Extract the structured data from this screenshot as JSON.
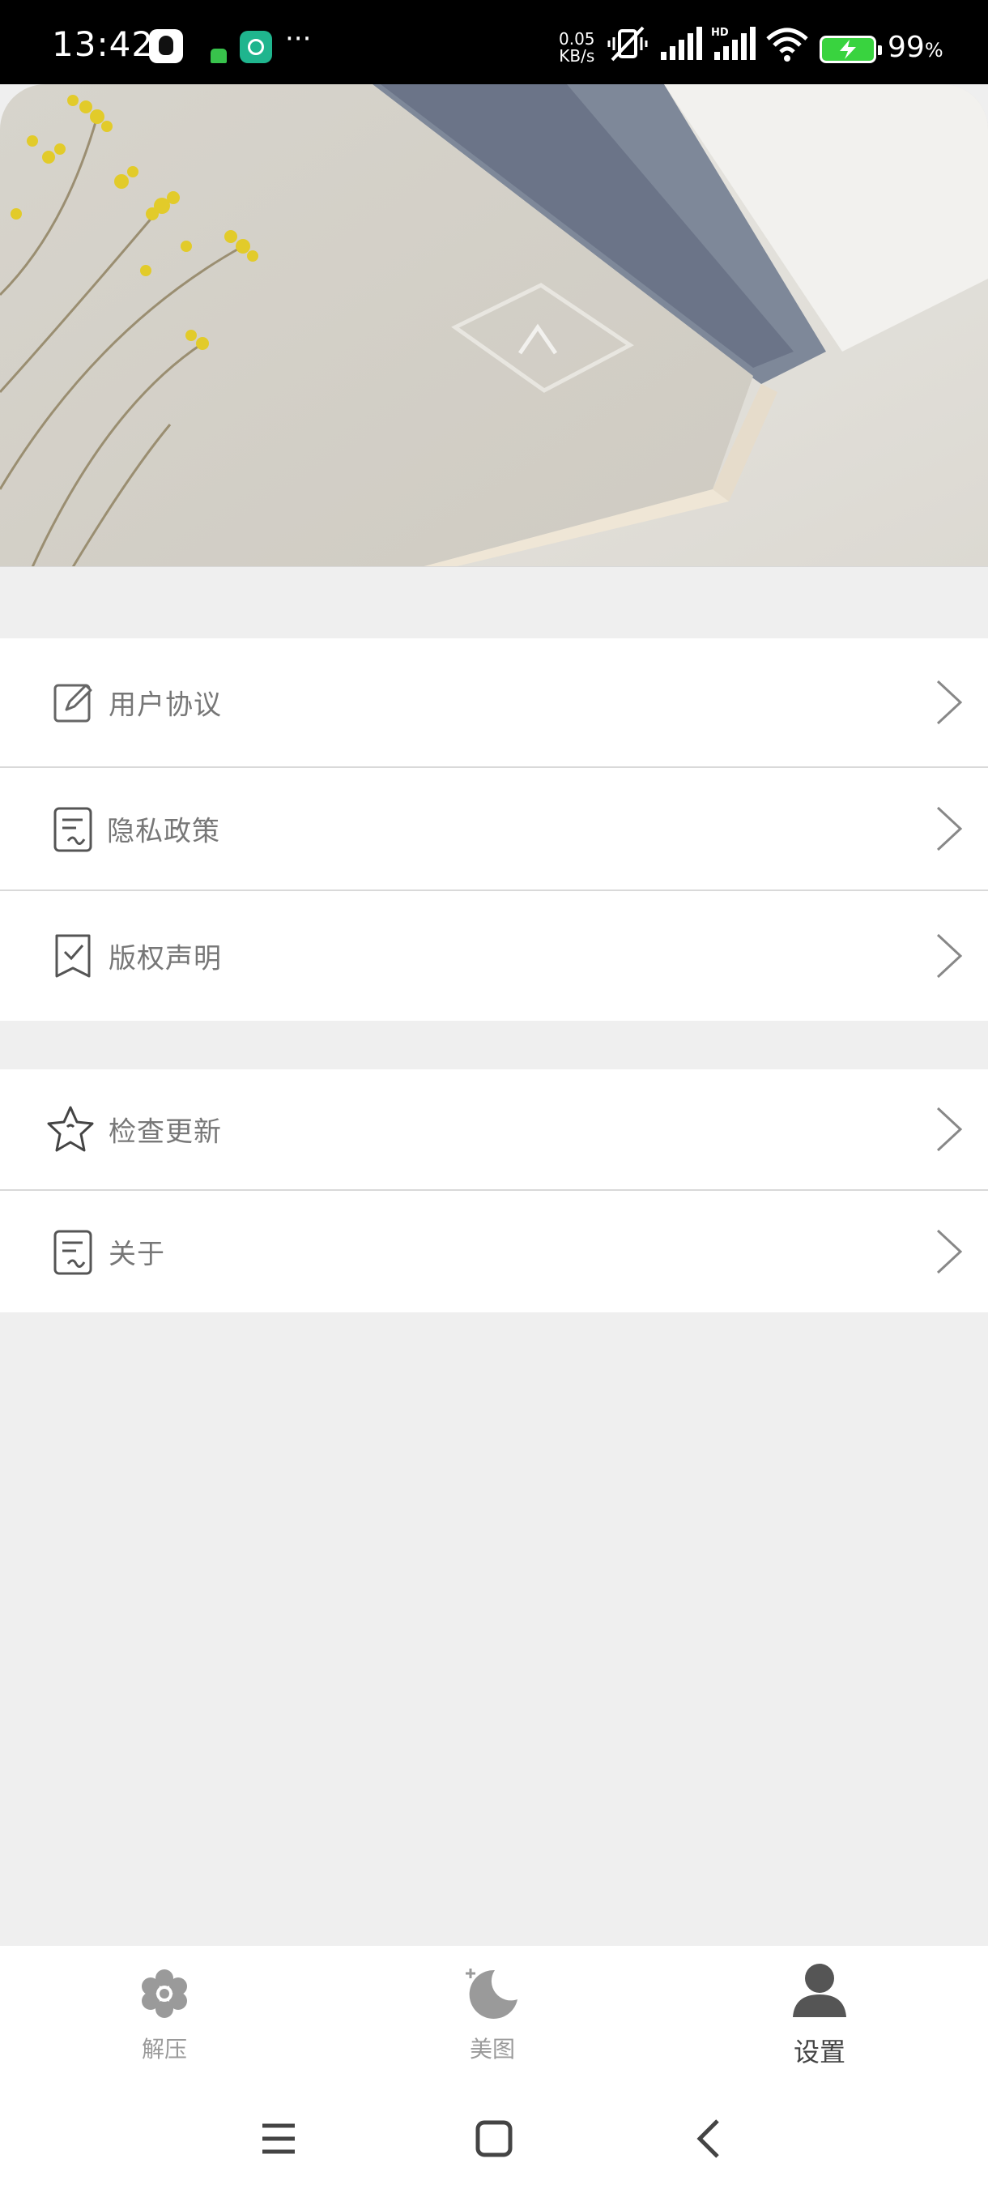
{
  "status_bar": {
    "time": "13:42",
    "net_speed_value": "0.05",
    "net_speed_unit": "KB/s",
    "battery_percent": "99",
    "battery_percent_sign": "%",
    "icons": [
      "qq-icon",
      "green-app-icon",
      "more-dots-icon",
      "vibrate-icon",
      "signal-icon",
      "hd-signal-icon",
      "wifi-icon",
      "battery-charging-icon"
    ]
  },
  "menu": {
    "group1": [
      {
        "label": "用户协议",
        "icon": "edit-icon"
      },
      {
        "label": "隐私政策",
        "icon": "document-icon"
      },
      {
        "label": "版权声明",
        "icon": "bookmark-check-icon"
      }
    ],
    "group2": [
      {
        "label": "检查更新",
        "icon": "star-icon"
      },
      {
        "label": "关于",
        "icon": "document-icon"
      }
    ]
  },
  "tabbar": {
    "tabs": [
      {
        "label": "解压",
        "icon": "flower-icon",
        "active": false
      },
      {
        "label": "美图",
        "icon": "moon-icon",
        "active": false
      },
      {
        "label": "设置",
        "icon": "user-icon",
        "active": true
      }
    ]
  },
  "colors": {
    "page_bg": "#efefef",
    "row_bg": "#ffffff",
    "divider": "#d9d9d9",
    "label_text": "#777777",
    "tab_inactive": "#9a9a9a",
    "tab_active": "#444444"
  }
}
